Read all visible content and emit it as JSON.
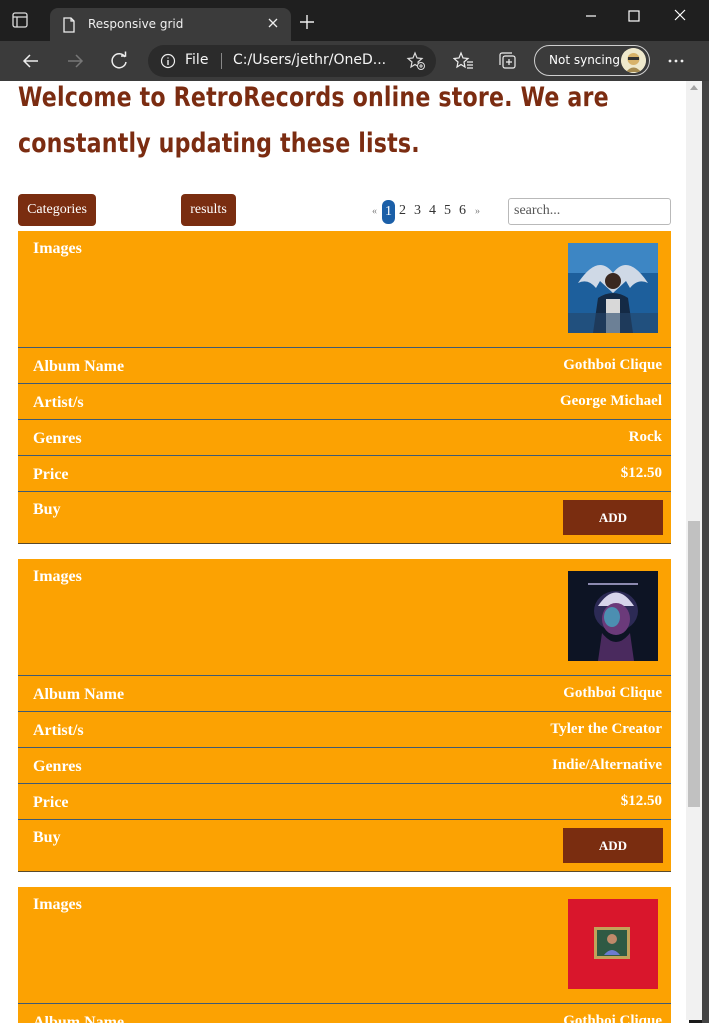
{
  "browser": {
    "tab_title": "Responsive grid",
    "address_scheme": "File",
    "address_url": "C:/Users/jethr/OneD...",
    "sync_label": "Not syncing"
  },
  "page": {
    "headline": "Welcome to RetroRecords online store. We are constantly updating these lists.",
    "categories_label": "Categories",
    "results_label": "results",
    "pagination": {
      "prev": "«",
      "pages": [
        "1",
        "2",
        "3",
        "4",
        "5",
        "6"
      ],
      "active": "1",
      "next": "»"
    },
    "search_placeholder": "search..."
  },
  "labels": {
    "images": "Images",
    "album_name": "Album Name",
    "artists": "Artist/s",
    "genres": "Genres",
    "price": "Price",
    "buy": "Buy",
    "add": "ADD"
  },
  "albums": [
    {
      "album_name": "Gothboi Clique",
      "artists": "George Michael",
      "genres": "Rock",
      "price": "$12.50"
    },
    {
      "album_name": "Gothboi Clique",
      "artists": "Tyler the Creator",
      "genres": "Indie/Alternative",
      "price": "$12.50"
    },
    {
      "album_name": "Gothboi Clique",
      "artists": "",
      "genres": "",
      "price": ""
    }
  ],
  "colors": {
    "card_bg": "#fca202",
    "brand_brown": "#7a2d10",
    "headline": "#7b2c11",
    "active_page": "#1b5fa8"
  }
}
